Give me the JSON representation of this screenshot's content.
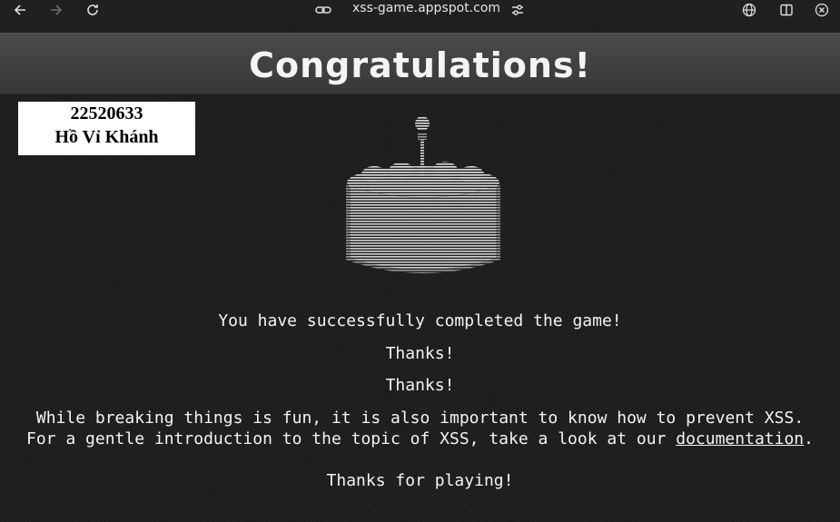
{
  "browser": {
    "url": "xss-game.appspot.com",
    "icons": [
      "back-arrow-icon",
      "forward-arrow-icon",
      "reload-icon",
      "site-info-icon",
      "page-settings-icon",
      "globe-icon",
      "sidebar-icon",
      "close-icon"
    ]
  },
  "page": {
    "title": "Congratulations!",
    "id_card": {
      "student_id": "22520633",
      "name": "Hồ Vỉ Khánh"
    },
    "messages": {
      "completed": "You have successfully completed the game!",
      "thanks_1": "Thanks!",
      "thanks_2": "Thanks!",
      "prevent_line": "While breaking things is fun, it is also important to know how to prevent XSS.",
      "intro_prefix": "For a gentle introduction to the topic of XSS, take a look at our ",
      "intro_link": "documentation",
      "intro_suffix": ".",
      "playing": "Thanks for playing!"
    }
  },
  "colors": {
    "background": "#1f1f1f",
    "banner": "#404040",
    "text": "#f4f4f4"
  }
}
